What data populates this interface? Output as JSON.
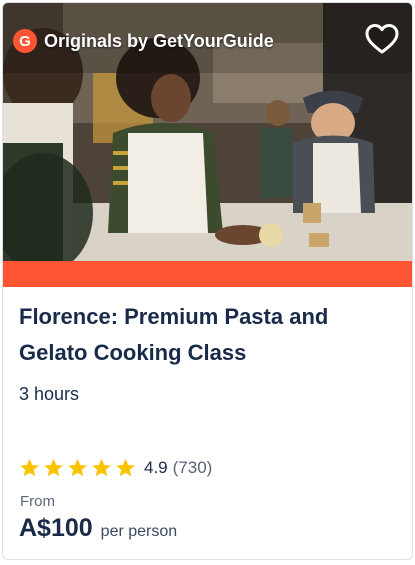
{
  "badge": {
    "logo_letter": "G",
    "text": "Originals by GetYourGuide",
    "icon": "getyourguide-logo-icon"
  },
  "wishlist": {
    "icon": "heart-outline-icon"
  },
  "colors": {
    "accent": "#ff5533",
    "title": "#1a2b49",
    "star": "#fdc500",
    "muted": "#5b6577"
  },
  "activity": {
    "title": "Florence: Premium Pasta and Gelato Cooking Class",
    "duration": "3 hours"
  },
  "rating": {
    "stars": 5,
    "value": "4.9",
    "count": "(730)",
    "star_icon": "star-icon"
  },
  "price": {
    "from_label": "From",
    "amount": "A$100",
    "per": "per person"
  }
}
